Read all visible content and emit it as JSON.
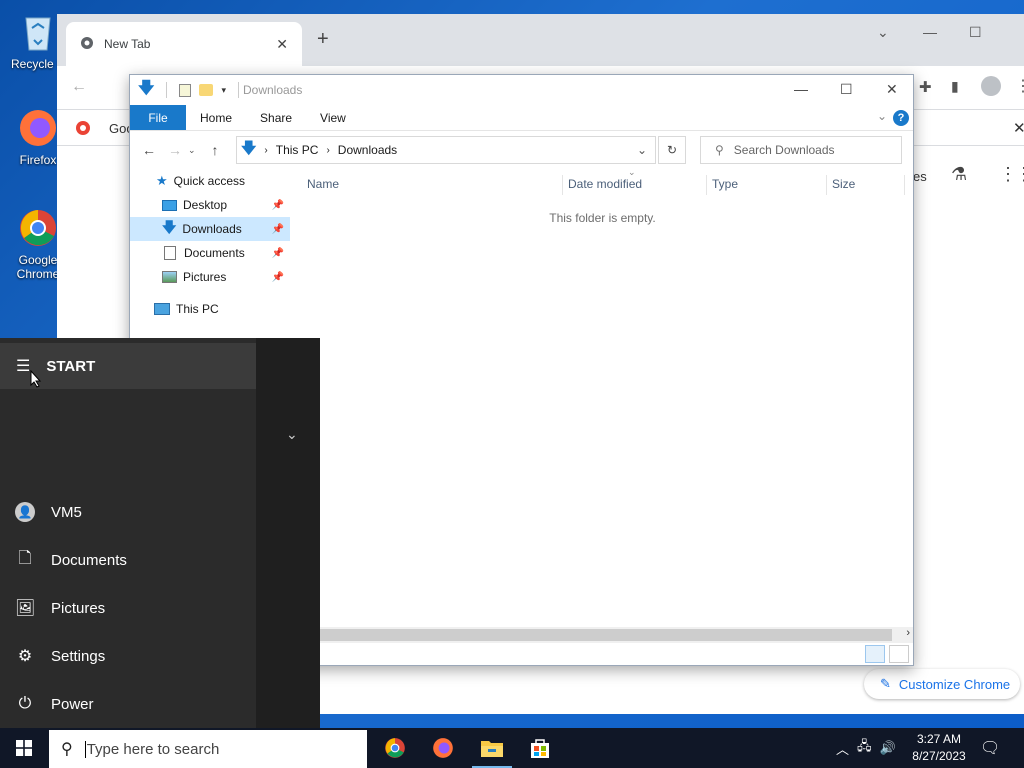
{
  "desktop": {
    "icons": [
      {
        "label": "Recycle B"
      },
      {
        "label": "Firefox"
      },
      {
        "label": "Google Chrome"
      }
    ]
  },
  "chrome": {
    "tab_title": "New Tab",
    "bookmark_partial": "Goo",
    "apps_partial": "es",
    "customize_label": "Customize Chrome"
  },
  "explorer": {
    "title": "Downloads",
    "ribbon": {
      "file": "File",
      "home": "Home",
      "share": "Share",
      "view": "View"
    },
    "breadcrumb": [
      "This PC",
      "Downloads"
    ],
    "search_placeholder": "Search Downloads",
    "sidebar": {
      "quick_access": "Quick access",
      "items": [
        {
          "label": "Desktop"
        },
        {
          "label": "Downloads"
        },
        {
          "label": "Documents"
        },
        {
          "label": "Pictures"
        }
      ],
      "this_pc": "This PC"
    },
    "columns": [
      "Name",
      "Date modified",
      "Type",
      "Size"
    ],
    "empty_message": "This folder is empty."
  },
  "start_menu": {
    "header": "START",
    "items": [
      {
        "label": "VM5"
      },
      {
        "label": "Documents"
      },
      {
        "label": "Pictures"
      },
      {
        "label": "Settings"
      },
      {
        "label": "Power"
      }
    ]
  },
  "taskbar": {
    "search_placeholder": "Type here to search",
    "time": "3:27 AM",
    "date": "8/27/2023"
  }
}
